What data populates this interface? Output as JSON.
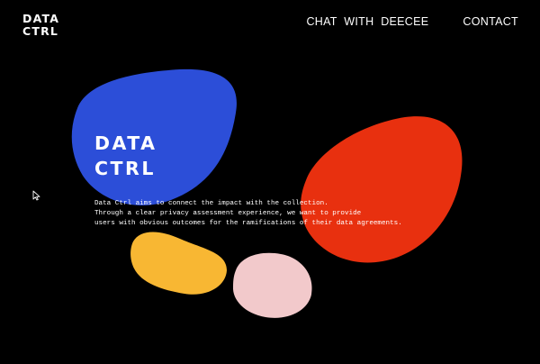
{
  "header": {
    "logo_line1": "DATA",
    "logo_line2": "CTRL",
    "nav": [
      {
        "label": "CHAT WITH DEECEE"
      },
      {
        "label": "CONTACT"
      }
    ]
  },
  "hero": {
    "title_line1": "DATA",
    "title_line2": "CTRL",
    "description_lines": [
      "Data Ctrl aims to connect the impact with the collection.",
      "Through a clear privacy assessment experience, we want to provide",
      "users with obvious outcomes for the ramifications of their data agreements."
    ]
  },
  "colors": {
    "background": "#000000",
    "blue_blob": "#2c4ed8",
    "red_blob": "#e8300f",
    "yellow_blob": "#f8b733",
    "pink_blob": "#f2c9cb",
    "text": "#ffffff"
  },
  "icons": [
    "mouse-pointer-icon"
  ]
}
